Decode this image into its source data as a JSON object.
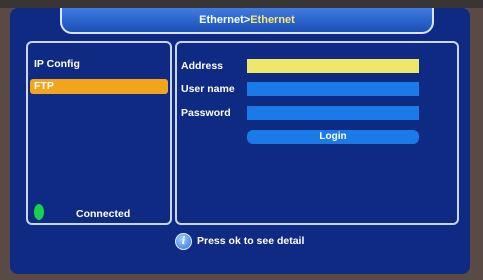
{
  "window": {
    "breadcrumb_parent": "Ethernet",
    "breadcrumb_separator": ">",
    "breadcrumb_current": "Ethernet"
  },
  "sidebar": {
    "items": [
      {
        "label": "IP Config",
        "selected": false
      },
      {
        "label": "FTP",
        "selected": true
      }
    ],
    "status": {
      "label": "Connected",
      "indicator_color": "#18d24c"
    }
  },
  "form": {
    "fields": [
      {
        "label": "Address",
        "value": "",
        "focused": true
      },
      {
        "label": "User name",
        "value": "",
        "focused": false
      },
      {
        "label": "Password",
        "value": "",
        "focused": false
      }
    ],
    "login_label": "Login"
  },
  "footer": {
    "icon": "info-icon",
    "hint": "Press ok to see detail"
  },
  "colors": {
    "background": "#0f2a82",
    "highlight": "#f0a51c",
    "field": "#1a7be8",
    "field_focused": "#eee86a",
    "title_current": "#ffe36a"
  }
}
